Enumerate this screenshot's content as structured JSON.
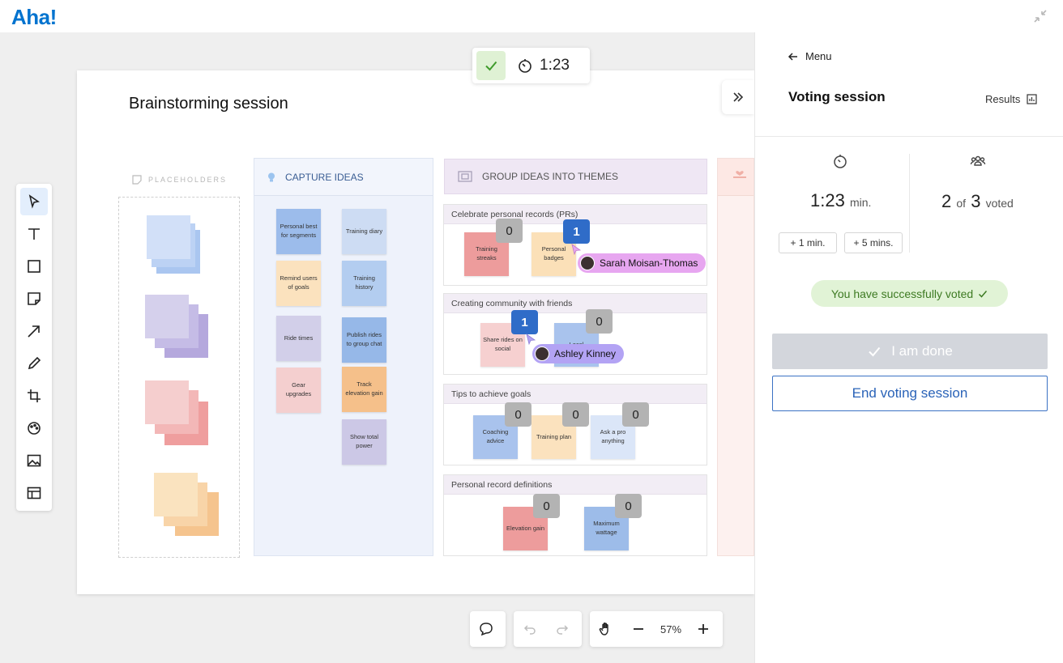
{
  "app": {
    "logo": "Aha!"
  },
  "board": {
    "title": "Brainstorming session"
  },
  "timer": {
    "value": "1:23"
  },
  "placeholders": {
    "label": "PLACEHOLDERS"
  },
  "capture": {
    "label": "CAPTURE IDEAS",
    "notes": [
      "Personal best for segments",
      "Training diary",
      "Remind users of goals",
      "Training history",
      "Ride times",
      "Publish rides to group chat",
      "Gear upgrades",
      "Track elevation gain",
      "Show total power"
    ]
  },
  "themes": {
    "label": "GROUP IDEAS INTO THEMES",
    "groups": [
      {
        "title": "Celebrate personal records (PRs)",
        "notes": [
          "Training streaks",
          "Personal badges"
        ],
        "votes": [
          "0",
          "1"
        ]
      },
      {
        "title": "Creating community with friends",
        "notes": [
          "Share rides on social",
          "Local"
        ],
        "votes": [
          "1",
          "0"
        ]
      },
      {
        "title": "Tips to achieve goals",
        "notes": [
          "Coaching advice",
          "Training plan",
          "Ask a pro anything"
        ],
        "votes": [
          "0",
          "0",
          "0"
        ]
      },
      {
        "title": "Personal record definitions",
        "notes": [
          "Elevation gain",
          "Maximum wattage"
        ],
        "votes": [
          "0",
          "0"
        ]
      }
    ]
  },
  "cursors": [
    {
      "name": "Sarah Moisan-Thomas",
      "color": "#e7a6f0"
    },
    {
      "name": "Ashley Kinney",
      "color": "#b3a3f4"
    }
  ],
  "zoom": {
    "level": "57%"
  },
  "panel": {
    "menu_label": "Menu",
    "title": "Voting session",
    "results_label": "Results",
    "time_value": "1:23",
    "time_unit": "min.",
    "add_1": "+ 1 min.",
    "add_5": "+ 5 mins.",
    "voted_count": "2",
    "voted_of": "of",
    "voted_total": "3",
    "voted_label": "voted",
    "success_message": "You have successfully voted",
    "done_label": "I am done",
    "end_label": "End voting session"
  },
  "colors": {
    "accent": "#0073cf",
    "vote_blue": "#2f6cc8",
    "success_bg": "#e1f3d6",
    "success_text": "#3d7a22"
  }
}
